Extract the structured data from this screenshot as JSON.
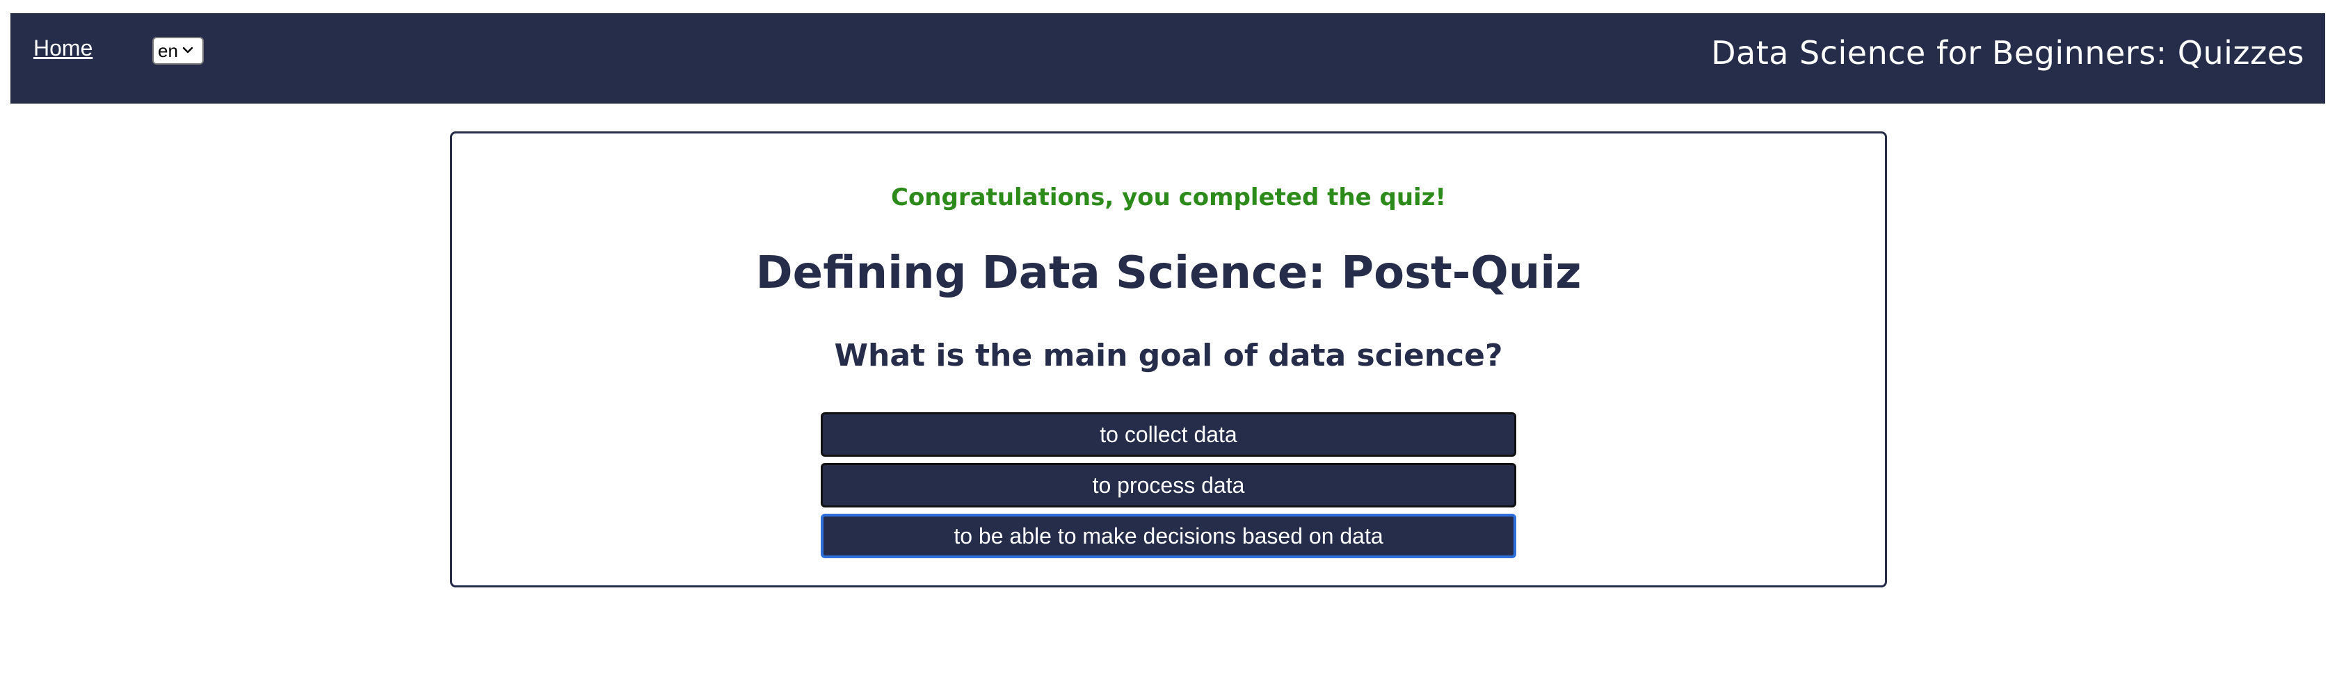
{
  "nav": {
    "home_label": "Home",
    "language_selected": "en",
    "site_title": "Data Science for Beginners: Quizzes"
  },
  "quiz": {
    "completion_message": "Congratulations, you completed the quiz!",
    "title": "Defining Data Science: Post-Quiz",
    "question": "What is the main goal of data science?",
    "answers": [
      {
        "label": "to collect data"
      },
      {
        "label": "to process data"
      },
      {
        "label": "to be able to make decisions based on data"
      }
    ]
  },
  "colors": {
    "nav_background": "#252d4a",
    "success_text": "#2c8a1a",
    "answer_background": "#252d4a",
    "focus_outline": "#2f6fdc"
  },
  "icons": {
    "language_dropdown": "chevron-down-icon"
  }
}
